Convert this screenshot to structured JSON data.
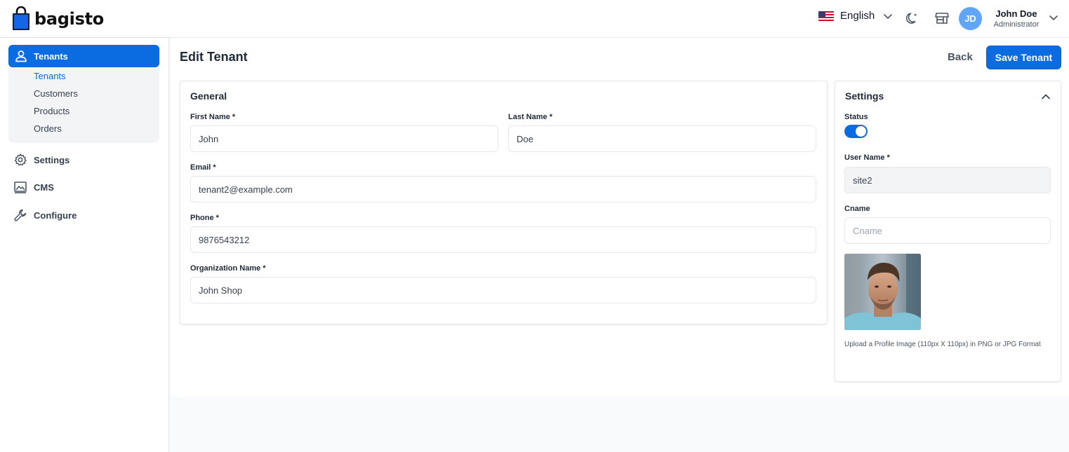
{
  "brand": {
    "name": "bagisto",
    "accent": "#0b6be0"
  },
  "header": {
    "language": "English",
    "user": {
      "initials": "JD",
      "name": "John Doe",
      "role": "Administrator"
    },
    "icons": [
      "us-flag-icon",
      "chevron-down-icon",
      "moon-icon",
      "storefront-icon"
    ]
  },
  "sidebar": {
    "active": {
      "label": "Tenants",
      "icon": "user-icon"
    },
    "sub_items": [
      {
        "label": "Tenants"
      },
      {
        "label": "Customers"
      },
      {
        "label": "Products"
      },
      {
        "label": "Orders"
      }
    ],
    "items": [
      {
        "label": "Settings",
        "icon": "gear-icon"
      },
      {
        "label": "CMS",
        "icon": "image-icon"
      },
      {
        "label": "Configure",
        "icon": "wrench-icon"
      }
    ]
  },
  "page": {
    "title": "Edit Tenant",
    "back_label": "Back",
    "save_label": "Save Tenant"
  },
  "general": {
    "title": "General",
    "first_name": {
      "label": "First Name *",
      "value": "John"
    },
    "last_name": {
      "label": "Last Name *",
      "value": "Doe"
    },
    "email": {
      "label": "Email *",
      "value": "tenant2@example.com"
    },
    "phone": {
      "label": "Phone *",
      "value": "9876543212"
    },
    "organization": {
      "label": "Organization Name *",
      "value": "John Shop"
    }
  },
  "settings": {
    "title": "Settings",
    "status": {
      "label": "Status",
      "enabled": true
    },
    "username": {
      "label": "User Name *",
      "value": "site2"
    },
    "cname": {
      "label": "Cname",
      "value": "",
      "placeholder": "Cname"
    },
    "profile_help": "Upload a Profile Image (110px X 110px) in PNG or JPG Format"
  }
}
